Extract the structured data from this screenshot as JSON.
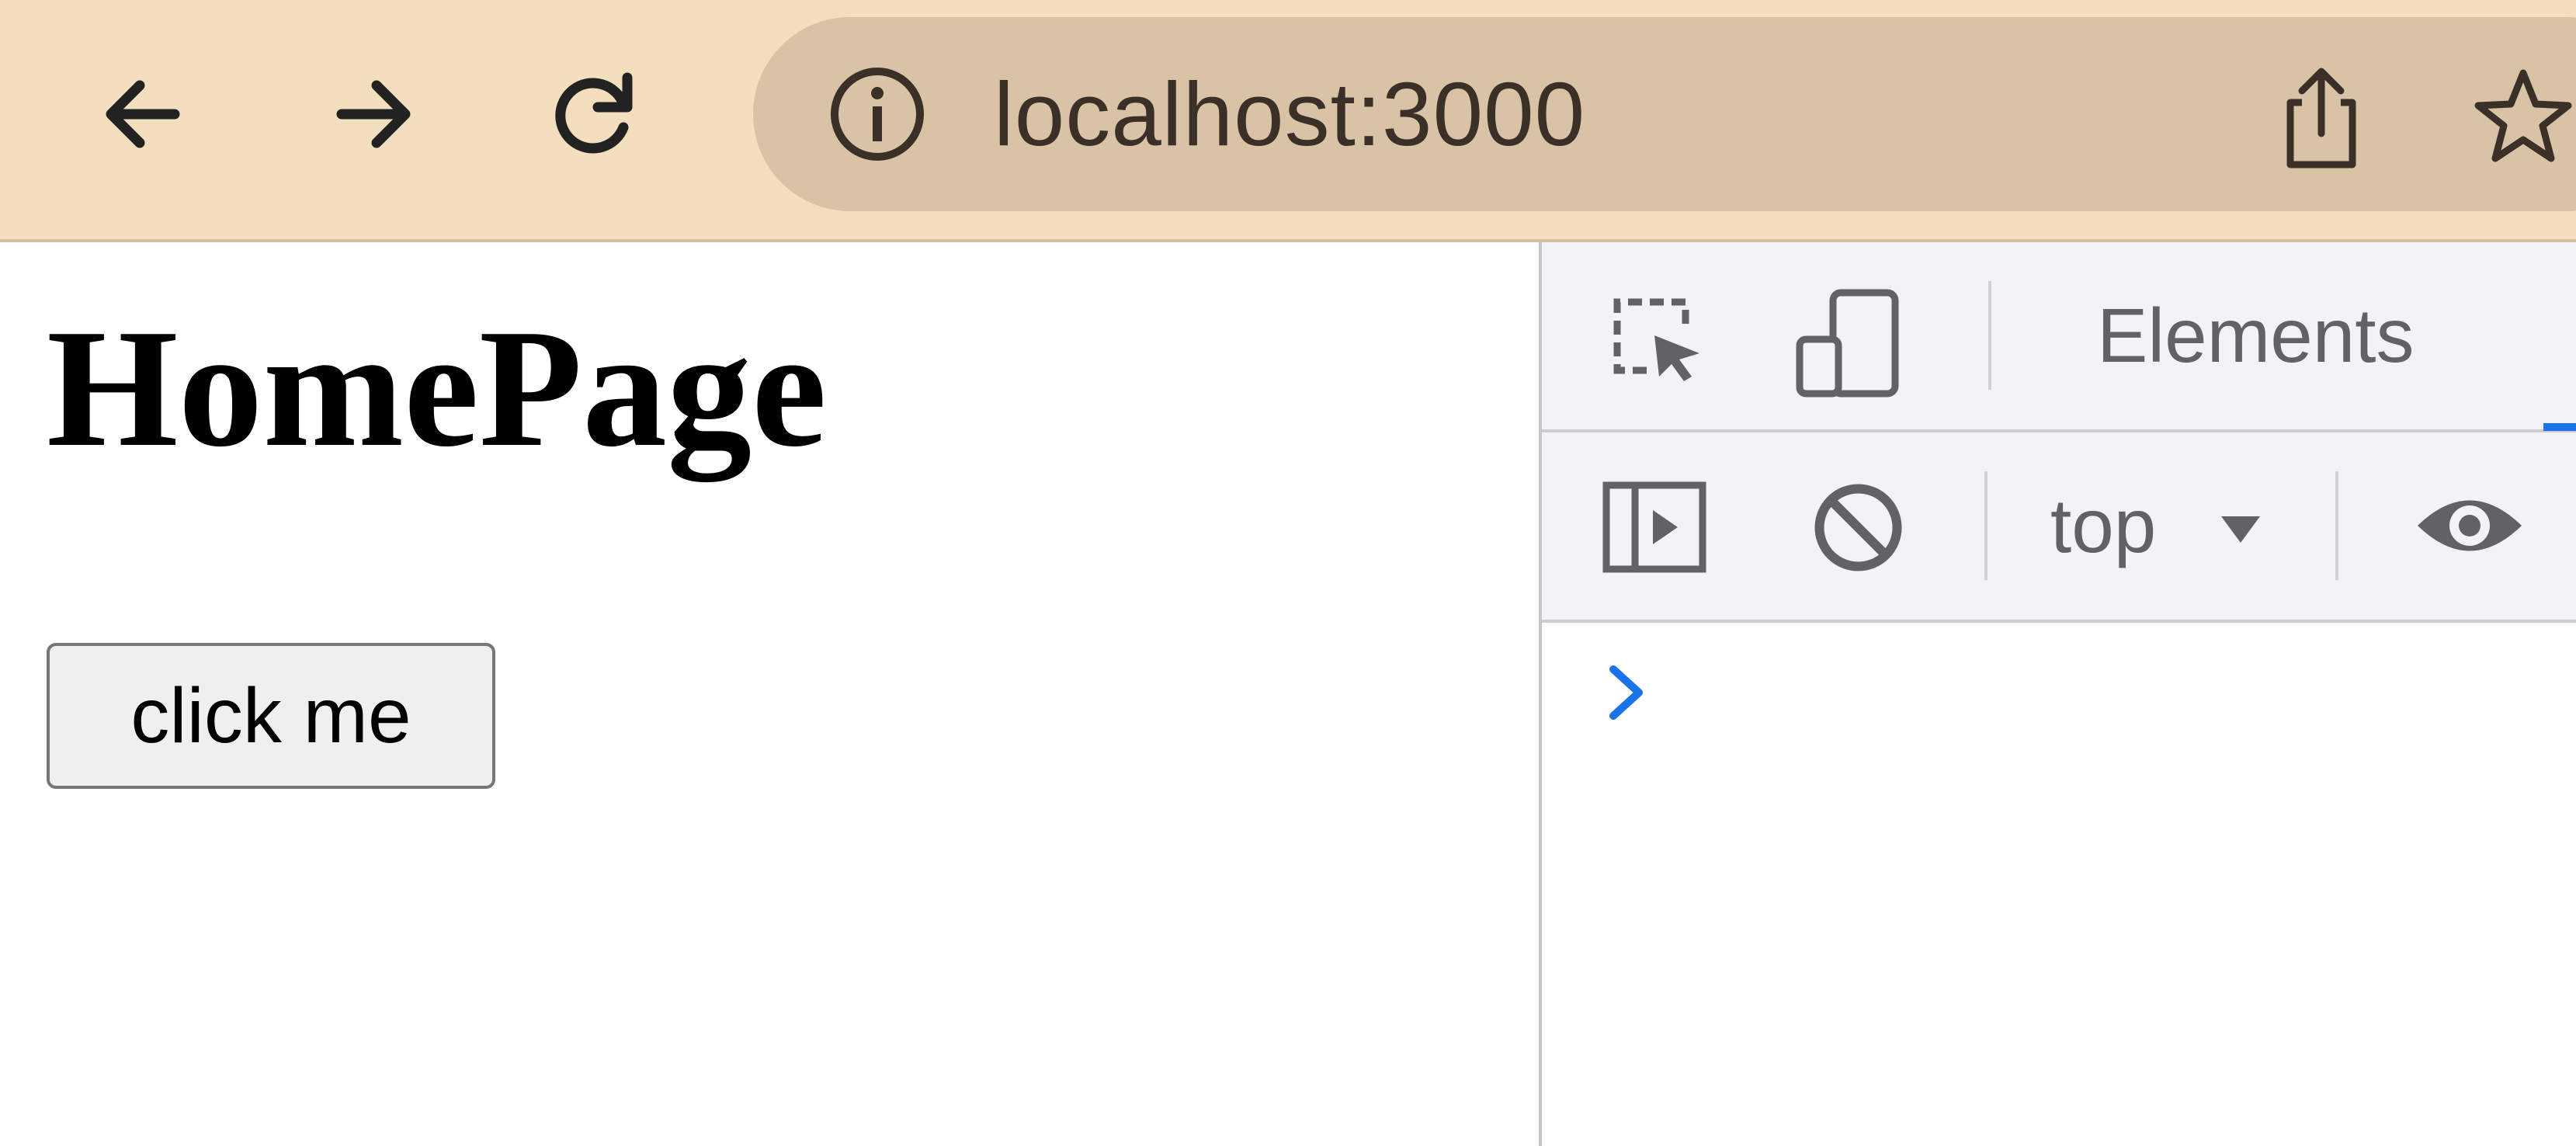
{
  "browser": {
    "url": "localhost:3000"
  },
  "page": {
    "heading": "HomePage",
    "button_label": "click me"
  },
  "devtools": {
    "tabs": [
      {
        "label": "Elements"
      }
    ],
    "console": {
      "context": "top"
    }
  },
  "colors": {
    "toolbar_bg": "#f3dfbd",
    "omnibox_bg": "#d8c3a6",
    "devtools_bg": "#f1f3f4",
    "accent": "#1a73e8"
  }
}
